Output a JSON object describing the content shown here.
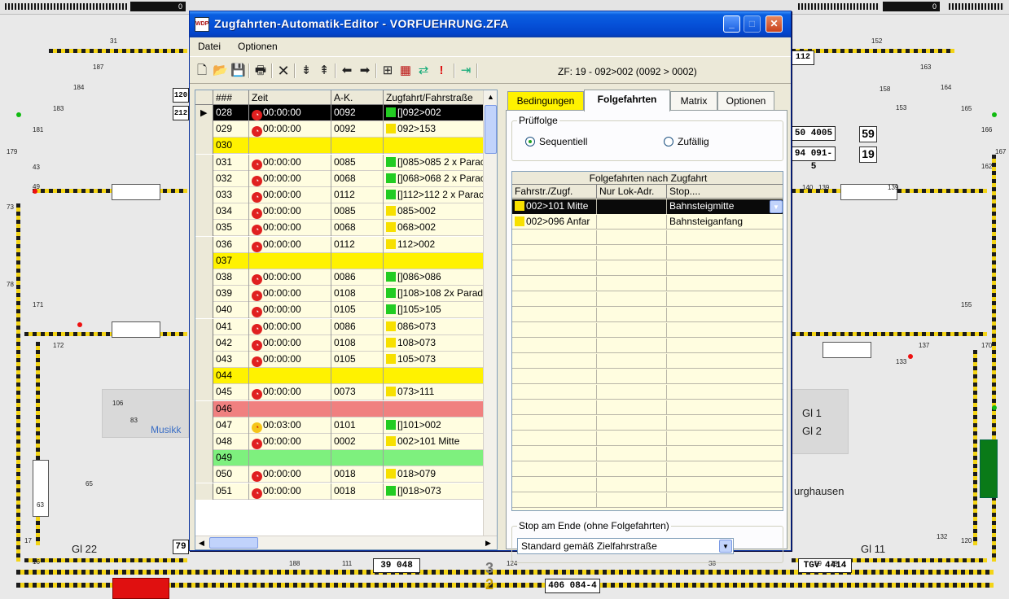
{
  "window": {
    "title": "Zugfahrten-Automatik-Editor - VORFUEHRUNG.ZFA",
    "app_icon_text": "WDP",
    "minimize": "_",
    "maximize": "□",
    "close": "✕"
  },
  "menu": [
    "Datei",
    "Optionen"
  ],
  "toolbar": {
    "status": "ZF: 19 - 092>002 (0092 > 0002)"
  },
  "grid": {
    "columns": [
      "###",
      "Zeit",
      "A-K.",
      "Zugfahrt/Fahrstraße"
    ],
    "rows": [
      {
        "id": "028",
        "time": "00:00:00",
        "ak": "0092",
        "route": "[]092>002",
        "mark": "green",
        "style": "selected"
      },
      {
        "id": "029",
        "time": "00:00:00",
        "ak": "0092",
        "route": "092>153",
        "mark": "yellow",
        "style": "normal"
      },
      {
        "id": "030",
        "time": "",
        "ak": "",
        "route": "",
        "mark": "",
        "style": "yellow"
      },
      {
        "id": "031",
        "time": "00:00:00",
        "ak": "0085",
        "route": "[]085>085 2 x Parac",
        "mark": "green",
        "style": "normal"
      },
      {
        "id": "032",
        "time": "00:00:00",
        "ak": "0068",
        "route": "[]068>068 2 x Parac",
        "mark": "green",
        "style": "normal"
      },
      {
        "id": "033",
        "time": "00:00:00",
        "ak": "0112",
        "route": "[]112>112 2 x Parac",
        "mark": "green",
        "style": "normal"
      },
      {
        "id": "034",
        "time": "00:00:00",
        "ak": "0085",
        "route": "085>002",
        "mark": "yellow",
        "style": "normal"
      },
      {
        "id": "035",
        "time": "00:00:00",
        "ak": "0068",
        "route": "068>002",
        "mark": "yellow",
        "style": "normal"
      },
      {
        "id": "036",
        "time": "00:00:00",
        "ak": "0112",
        "route": "112>002",
        "mark": "yellow",
        "style": "normal"
      },
      {
        "id": "037",
        "time": "",
        "ak": "",
        "route": "",
        "mark": "",
        "style": "yellow"
      },
      {
        "id": "038",
        "time": "00:00:00",
        "ak": "0086",
        "route": "[]086>086",
        "mark": "green",
        "style": "normal"
      },
      {
        "id": "039",
        "time": "00:00:00",
        "ak": "0108",
        "route": "[]108>108 2x Parade",
        "mark": "green",
        "style": "normal"
      },
      {
        "id": "040",
        "time": "00:00:00",
        "ak": "0105",
        "route": "[]105>105",
        "mark": "green",
        "style": "normal"
      },
      {
        "id": "041",
        "time": "00:00:00",
        "ak": "0086",
        "route": "086>073",
        "mark": "yellow",
        "style": "normal"
      },
      {
        "id": "042",
        "time": "00:00:00",
        "ak": "0108",
        "route": "108>073",
        "mark": "yellow",
        "style": "normal"
      },
      {
        "id": "043",
        "time": "00:00:00",
        "ak": "0105",
        "route": "105>073",
        "mark": "yellow",
        "style": "normal"
      },
      {
        "id": "044",
        "time": "",
        "ak": "",
        "route": "",
        "mark": "",
        "style": "yellow"
      },
      {
        "id": "045",
        "time": "00:00:00",
        "ak": "0073",
        "route": "073>111",
        "mark": "yellow",
        "style": "normal"
      },
      {
        "id": "046",
        "time": "",
        "ak": "",
        "route": "",
        "mark": "",
        "style": "red"
      },
      {
        "id": "047",
        "time": "00:03:00",
        "ak": "0101",
        "route": "[]101>002",
        "mark": "green",
        "style": "normal",
        "clock": "yellow"
      },
      {
        "id": "048",
        "time": "00:00:00",
        "ak": "0002",
        "route": "002>101 Mitte",
        "mark": "yellow",
        "style": "normal"
      },
      {
        "id": "049",
        "time": "",
        "ak": "",
        "route": "",
        "mark": "",
        "style": "green"
      },
      {
        "id": "050",
        "time": "00:00:00",
        "ak": "0018",
        "route": "018>079",
        "mark": "yellow",
        "style": "normal"
      },
      {
        "id": "051",
        "time": "00:00:00",
        "ak": "0018",
        "route": "[]018>073",
        "mark": "green",
        "style": "normal"
      }
    ]
  },
  "tabs": [
    "Bedingungen",
    "Folgefahrten",
    "Matrix",
    "Optionen"
  ],
  "folgefahrten": {
    "pruefolge_label": "Prüffolge",
    "radio_sequential": "Sequentiell",
    "radio_random": "Zufällig",
    "table_title": "Folgefahrten nach Zugfahrt",
    "columns": [
      "Fahrstr./Zugf.",
      "Nur Lok-Adr.",
      "Stop...."
    ],
    "rows": [
      {
        "route": "002>101 Mitte",
        "lok": "",
        "stop": "Bahnsteigmitte",
        "selected": true
      },
      {
        "route": "002>096 Anfar",
        "lok": "",
        "stop": "Bahnsteiganfang",
        "selected": false
      }
    ],
    "stop_group_label": "Stop am Ende (ohne Folgefahrten)",
    "stop_value": "Standard gemäß Zielfahrstraße"
  },
  "background": {
    "labels": {
      "musik": "Musikk",
      "gl1": "Gl 1",
      "gl2": "Gl 2",
      "gl22": "Gl 22",
      "gl11": "Gl 11",
      "burghausen": "urghausen",
      "top_left_num": "0",
      "top_right_num": "0"
    },
    "locos": {
      "l1": "39 048",
      "l2": "406 084-4",
      "l3": "TGV 4414",
      "l4": "50 4005",
      "l5": "94 091-5",
      "l6": "79",
      "b59": "59",
      "b19": "19",
      "b120": "120",
      "b212": "212",
      "b112": "112",
      "n3": "3",
      "n2": "2"
    },
    "track_numbers": [
      "31",
      "187",
      "184",
      "183",
      "181",
      "179",
      "43",
      "49",
      "73",
      "78",
      "171",
      "172",
      "106",
      "83",
      "65",
      "63",
      "17",
      "16",
      "188",
      "111",
      "124",
      "38",
      "133",
      "132",
      "120",
      "162",
      "167",
      "158",
      "155",
      "170",
      "137",
      "139",
      "140",
      "139",
      "59",
      "19",
      "152",
      "153",
      "163",
      "164",
      "165",
      "166"
    ]
  }
}
